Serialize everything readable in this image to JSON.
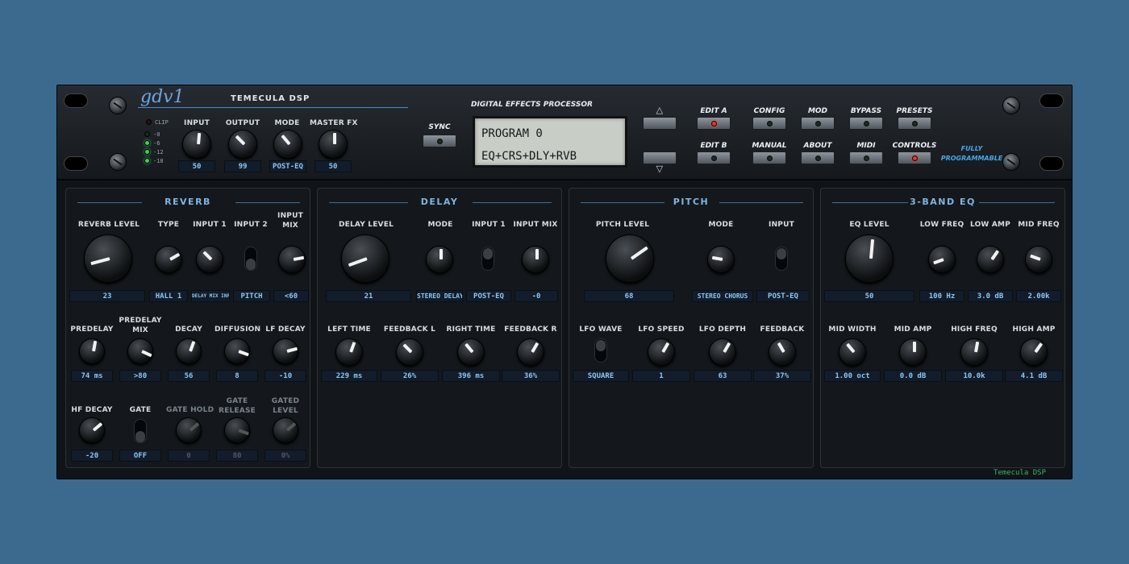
{
  "header": {
    "logo": "gdv1",
    "brand": "TEMECULA DSP",
    "subtitle": "DIGITAL EFFECTS PROCESSOR",
    "clip_label": "CLIP",
    "meter_labels": [
      "-0",
      "-6",
      "-12",
      "-18"
    ],
    "knobs": [
      {
        "label": "INPUT",
        "value": "50"
      },
      {
        "label": "OUTPUT",
        "value": "99"
      },
      {
        "label": "MODE",
        "value": "POST-EQ"
      },
      {
        "label": "MASTER FX",
        "value": "50"
      }
    ],
    "sync_label": "SYNC",
    "lcd_line1": "PROGRAM 0",
    "lcd_line2": "EQ+CRS+DLY+RVB",
    "arrow_up": "△",
    "arrow_down": "▽",
    "buttons_row1": [
      "EDIT A",
      "CONFIG",
      "MOD",
      "BYPASS",
      "PRESETS"
    ],
    "buttons_row2": [
      "EDIT B",
      "MANUAL",
      "ABOUT",
      "MIDI",
      "CONTROLS"
    ],
    "fully_line1": "FULLY",
    "fully_line2": "PROGRAMMABLE"
  },
  "reverb": {
    "title": "REVERB",
    "reverb_level": {
      "label": "REVERB LEVEL",
      "value": "23"
    },
    "type": {
      "label": "TYPE",
      "value": "HALL 1"
    },
    "input1": {
      "label": "INPUT 1",
      "value": "DELAY MIX INPUT"
    },
    "input2": {
      "label": "INPUT 2",
      "value": "PITCH"
    },
    "input_mix": {
      "label": "INPUT MIX",
      "value": "<60"
    },
    "predelay": {
      "label": "PREDELAY",
      "value": "74 ms"
    },
    "predelay_mix": {
      "label": "PREDELAY MIX",
      "value": ">80"
    },
    "decay": {
      "label": "DECAY",
      "value": "56"
    },
    "diffusion": {
      "label": "DIFFUSION",
      "value": "8"
    },
    "lf_decay": {
      "label": "LF DECAY",
      "value": "-10"
    },
    "hf_decay": {
      "label": "HF DECAY",
      "value": "-20"
    },
    "gate": {
      "label": "GATE",
      "value": "OFF"
    },
    "gate_hold": {
      "label": "GATE HOLD",
      "value": "0"
    },
    "gate_release": {
      "label": "GATE RELEASE",
      "value": "80"
    },
    "gated_level": {
      "label": "GATED LEVEL",
      "value": "0%"
    }
  },
  "delay": {
    "title": "DELAY",
    "delay_level": {
      "label": "DELAY LEVEL",
      "value": "21"
    },
    "mode": {
      "label": "MODE",
      "value": "STEREO DELAY"
    },
    "input1": {
      "label": "INPUT 1",
      "value": "POST-EQ"
    },
    "input_mix": {
      "label": "INPUT MIX",
      "value": "-0"
    },
    "left_time": {
      "label": "LEFT TIME",
      "value": "229 ms"
    },
    "feedback_l": {
      "label": "FEEDBACK L",
      "value": "26%"
    },
    "right_time": {
      "label": "RIGHT TIME",
      "value": "396 ms"
    },
    "feedback_r": {
      "label": "FEEDBACK R",
      "value": "36%"
    }
  },
  "pitch": {
    "title": "PITCH",
    "pitch_level": {
      "label": "PITCH LEVEL",
      "value": "68"
    },
    "mode": {
      "label": "MODE",
      "value": "STEREO CHORUS"
    },
    "input": {
      "label": "INPUT",
      "value": "POST-EQ"
    },
    "lfo_wave": {
      "label": "LFO WAVE",
      "value": "SQUARE"
    },
    "lfo_speed": {
      "label": "LFO SPEED",
      "value": "1"
    },
    "lfo_depth": {
      "label": "LFO DEPTH",
      "value": "63"
    },
    "feedback": {
      "label": "FEEDBACK",
      "value": "37%"
    }
  },
  "eq": {
    "title": "3-BAND EQ",
    "eq_level": {
      "label": "EQ LEVEL",
      "value": "50"
    },
    "low_freq": {
      "label": "LOW FREQ",
      "value": "100 Hz"
    },
    "low_amp": {
      "label": "LOW AMP",
      "value": "3.0 dB"
    },
    "mid_freq": {
      "label": "MID FREQ",
      "value": "2.00k"
    },
    "mid_width": {
      "label": "MID WIDTH",
      "value": "1.00 oct"
    },
    "mid_amp": {
      "label": "MID AMP",
      "value": "0.0 dB"
    },
    "high_freq": {
      "label": "HIGH FREQ",
      "value": "10.0k"
    },
    "high_amp": {
      "label": "HIGH AMP",
      "value": "4.1 dB"
    }
  },
  "footer": "Temecula DSP",
  "colors": {
    "background": "#3c6a8f",
    "accent": "#7fb4e2",
    "led_red": "#e23a2a",
    "led_green": "#3fd05a"
  }
}
